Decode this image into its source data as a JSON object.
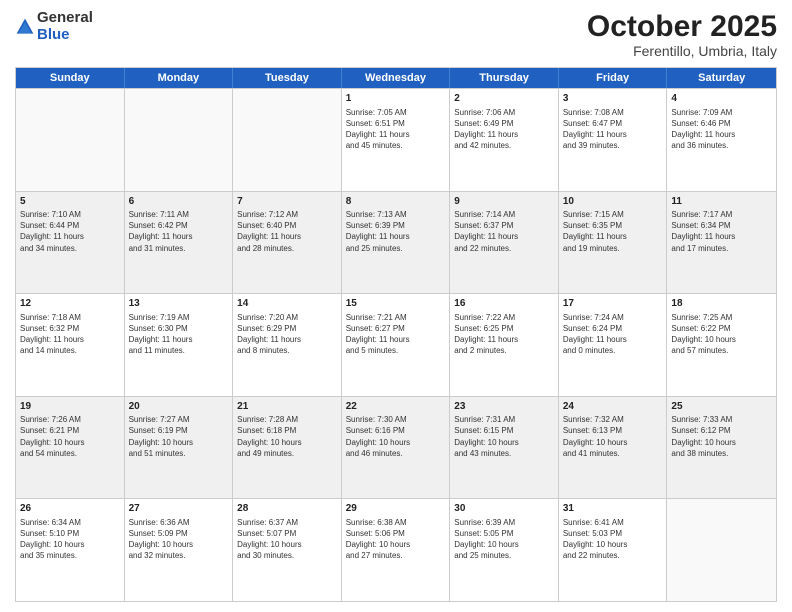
{
  "header": {
    "logo_general": "General",
    "logo_blue": "Blue",
    "month": "October 2025",
    "location": "Ferentillo, Umbria, Italy"
  },
  "days_of_week": [
    "Sunday",
    "Monday",
    "Tuesday",
    "Wednesday",
    "Thursday",
    "Friday",
    "Saturday"
  ],
  "weeks": [
    [
      {
        "day": "",
        "info": "",
        "empty": true
      },
      {
        "day": "",
        "info": "",
        "empty": true
      },
      {
        "day": "",
        "info": "",
        "empty": true
      },
      {
        "day": "1",
        "info": "Sunrise: 7:05 AM\nSunset: 6:51 PM\nDaylight: 11 hours\nand 45 minutes.",
        "empty": false
      },
      {
        "day": "2",
        "info": "Sunrise: 7:06 AM\nSunset: 6:49 PM\nDaylight: 11 hours\nand 42 minutes.",
        "empty": false
      },
      {
        "day": "3",
        "info": "Sunrise: 7:08 AM\nSunset: 6:47 PM\nDaylight: 11 hours\nand 39 minutes.",
        "empty": false
      },
      {
        "day": "4",
        "info": "Sunrise: 7:09 AM\nSunset: 6:46 PM\nDaylight: 11 hours\nand 36 minutes.",
        "empty": false
      }
    ],
    [
      {
        "day": "5",
        "info": "Sunrise: 7:10 AM\nSunset: 6:44 PM\nDaylight: 11 hours\nand 34 minutes.",
        "empty": false
      },
      {
        "day": "6",
        "info": "Sunrise: 7:11 AM\nSunset: 6:42 PM\nDaylight: 11 hours\nand 31 minutes.",
        "empty": false
      },
      {
        "day": "7",
        "info": "Sunrise: 7:12 AM\nSunset: 6:40 PM\nDaylight: 11 hours\nand 28 minutes.",
        "empty": false
      },
      {
        "day": "8",
        "info": "Sunrise: 7:13 AM\nSunset: 6:39 PM\nDaylight: 11 hours\nand 25 minutes.",
        "empty": false
      },
      {
        "day": "9",
        "info": "Sunrise: 7:14 AM\nSunset: 6:37 PM\nDaylight: 11 hours\nand 22 minutes.",
        "empty": false
      },
      {
        "day": "10",
        "info": "Sunrise: 7:15 AM\nSunset: 6:35 PM\nDaylight: 11 hours\nand 19 minutes.",
        "empty": false
      },
      {
        "day": "11",
        "info": "Sunrise: 7:17 AM\nSunset: 6:34 PM\nDaylight: 11 hours\nand 17 minutes.",
        "empty": false
      }
    ],
    [
      {
        "day": "12",
        "info": "Sunrise: 7:18 AM\nSunset: 6:32 PM\nDaylight: 11 hours\nand 14 minutes.",
        "empty": false
      },
      {
        "day": "13",
        "info": "Sunrise: 7:19 AM\nSunset: 6:30 PM\nDaylight: 11 hours\nand 11 minutes.",
        "empty": false
      },
      {
        "day": "14",
        "info": "Sunrise: 7:20 AM\nSunset: 6:29 PM\nDaylight: 11 hours\nand 8 minutes.",
        "empty": false
      },
      {
        "day": "15",
        "info": "Sunrise: 7:21 AM\nSunset: 6:27 PM\nDaylight: 11 hours\nand 5 minutes.",
        "empty": false
      },
      {
        "day": "16",
        "info": "Sunrise: 7:22 AM\nSunset: 6:25 PM\nDaylight: 11 hours\nand 2 minutes.",
        "empty": false
      },
      {
        "day": "17",
        "info": "Sunrise: 7:24 AM\nSunset: 6:24 PM\nDaylight: 11 hours\nand 0 minutes.",
        "empty": false
      },
      {
        "day": "18",
        "info": "Sunrise: 7:25 AM\nSunset: 6:22 PM\nDaylight: 10 hours\nand 57 minutes.",
        "empty": false
      }
    ],
    [
      {
        "day": "19",
        "info": "Sunrise: 7:26 AM\nSunset: 6:21 PM\nDaylight: 10 hours\nand 54 minutes.",
        "empty": false
      },
      {
        "day": "20",
        "info": "Sunrise: 7:27 AM\nSunset: 6:19 PM\nDaylight: 10 hours\nand 51 minutes.",
        "empty": false
      },
      {
        "day": "21",
        "info": "Sunrise: 7:28 AM\nSunset: 6:18 PM\nDaylight: 10 hours\nand 49 minutes.",
        "empty": false
      },
      {
        "day": "22",
        "info": "Sunrise: 7:30 AM\nSunset: 6:16 PM\nDaylight: 10 hours\nand 46 minutes.",
        "empty": false
      },
      {
        "day": "23",
        "info": "Sunrise: 7:31 AM\nSunset: 6:15 PM\nDaylight: 10 hours\nand 43 minutes.",
        "empty": false
      },
      {
        "day": "24",
        "info": "Sunrise: 7:32 AM\nSunset: 6:13 PM\nDaylight: 10 hours\nand 41 minutes.",
        "empty": false
      },
      {
        "day": "25",
        "info": "Sunrise: 7:33 AM\nSunset: 6:12 PM\nDaylight: 10 hours\nand 38 minutes.",
        "empty": false
      }
    ],
    [
      {
        "day": "26",
        "info": "Sunrise: 6:34 AM\nSunset: 5:10 PM\nDaylight: 10 hours\nand 35 minutes.",
        "empty": false
      },
      {
        "day": "27",
        "info": "Sunrise: 6:36 AM\nSunset: 5:09 PM\nDaylight: 10 hours\nand 32 minutes.",
        "empty": false
      },
      {
        "day": "28",
        "info": "Sunrise: 6:37 AM\nSunset: 5:07 PM\nDaylight: 10 hours\nand 30 minutes.",
        "empty": false
      },
      {
        "day": "29",
        "info": "Sunrise: 6:38 AM\nSunset: 5:06 PM\nDaylight: 10 hours\nand 27 minutes.",
        "empty": false
      },
      {
        "day": "30",
        "info": "Sunrise: 6:39 AM\nSunset: 5:05 PM\nDaylight: 10 hours\nand 25 minutes.",
        "empty": false
      },
      {
        "day": "31",
        "info": "Sunrise: 6:41 AM\nSunset: 5:03 PM\nDaylight: 10 hours\nand 22 minutes.",
        "empty": false
      },
      {
        "day": "",
        "info": "",
        "empty": true
      }
    ]
  ]
}
